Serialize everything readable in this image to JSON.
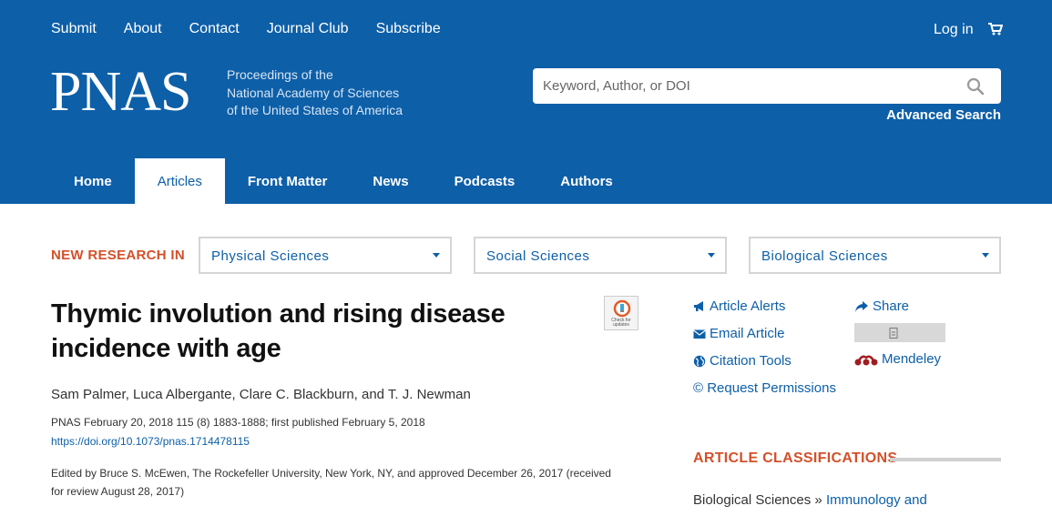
{
  "header": {
    "top_links": [
      "Submit",
      "About",
      "Contact",
      "Journal Club",
      "Subscribe"
    ],
    "login": "Log in",
    "logo": "PNAS",
    "tagline": [
      "Proceedings of the",
      "National Academy of Sciences",
      "of the United States of America"
    ],
    "search_placeholder": "Keyword, Author, or DOI",
    "advanced_search": "Advanced Search",
    "main_tabs": [
      "Home",
      "Articles",
      "Front Matter",
      "News",
      "Podcasts",
      "Authors"
    ],
    "active_tab": "Articles",
    "brand_color": "#0d5fa8"
  },
  "research_bar": {
    "label": "NEW RESEARCH IN",
    "dropdowns": [
      "Physical Sciences",
      "Social Sciences",
      "Biological Sciences"
    ],
    "accent_color": "#d4502a"
  },
  "article": {
    "title_line1": "Thymic involution and rising disease",
    "title_line2": "incidence with age",
    "badge_text": "Check for updates",
    "authors": "Sam Palmer, Luca Albergante, Clare C. Blackburn, and T. J. Newman",
    "citation": "PNAS February 20, 2018 115 (8) 1883-1888; first published February 5, 2018",
    "doi": "https://doi.org/10.1073/pnas.1714478115",
    "edited_line1": "Edited by Bruce S. McEwen, The Rockefeller University, New York, NY, and approved December 26, 2017 (received",
    "edited_line2": "for review August 28, 2017)"
  },
  "sidebar": {
    "tools": [
      {
        "label": "Article Alerts",
        "icon": "bullhorn-icon"
      },
      {
        "label": "Email Article",
        "icon": "envelope-icon"
      },
      {
        "label": "Citation Tools",
        "icon": "globe-icon"
      },
      {
        "label": "© Request Permissions",
        "icon": "copyright-icon"
      }
    ],
    "share": "Share",
    "mendeley": "Mendeley",
    "classifications_heading": "ARTICLE CLASSIFICATIONS",
    "classification_category": "Biological Sciences",
    "classification_sep": "»",
    "classification_sub": "Immunology and"
  }
}
